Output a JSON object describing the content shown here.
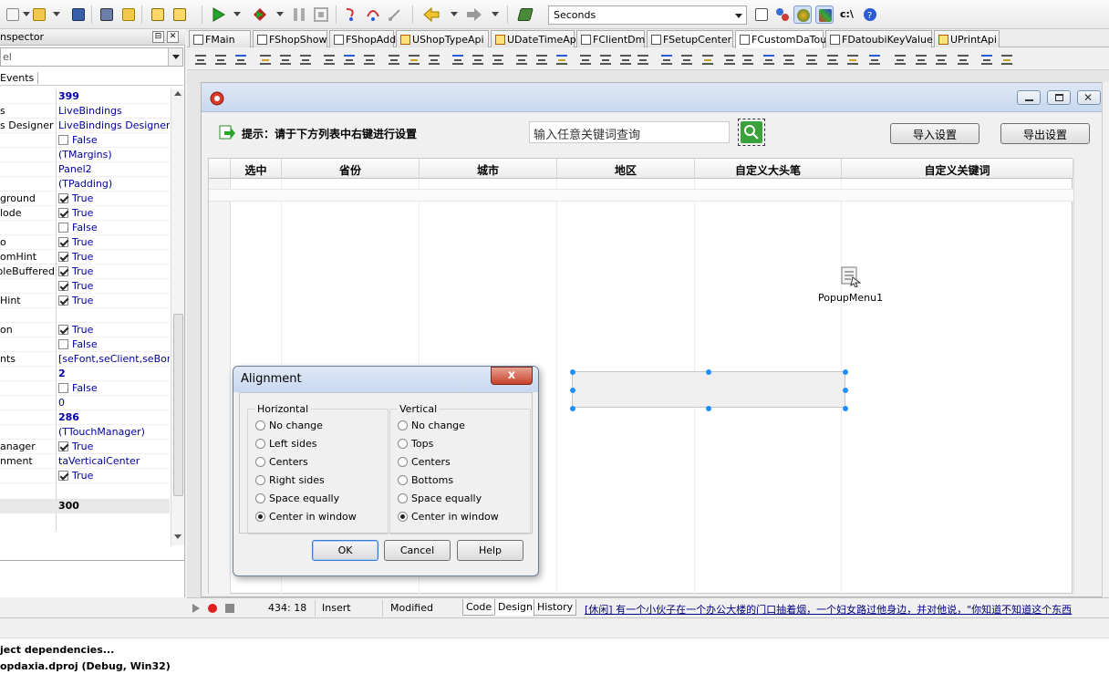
{
  "toolbar": {
    "seconds_value": "Seconds",
    "path_label": "c:\\"
  },
  "inspector": {
    "title": "nspector",
    "combo_value": "el",
    "events_tab": "Events",
    "rows": [
      {
        "name": "",
        "value": "399",
        "bold": true,
        "check": null
      },
      {
        "name": "s",
        "value": "LiveBindings",
        "bold": false,
        "check": null
      },
      {
        "name": "s Designer",
        "value": "LiveBindings Designer",
        "bold": false,
        "check": null
      },
      {
        "name": "",
        "value": "False",
        "bold": false,
        "check": false
      },
      {
        "name": "",
        "value": "(TMargins)",
        "bold": false,
        "check": null
      },
      {
        "name": "",
        "value": "Panel2",
        "bold": false,
        "check": null
      },
      {
        "name": "",
        "value": "(TPadding)",
        "bold": false,
        "check": null
      },
      {
        "name": "ground",
        "value": "True",
        "bold": false,
        "check": true
      },
      {
        "name": "lode",
        "value": "True",
        "bold": false,
        "check": true
      },
      {
        "name": "",
        "value": "False",
        "bold": false,
        "check": false
      },
      {
        "name": "o",
        "value": "True",
        "bold": false,
        "check": true
      },
      {
        "name": "omHint",
        "value": "True",
        "bold": false,
        "check": true
      },
      {
        "name": "oleBuffered",
        "value": "True",
        "bold": false,
        "check": true
      },
      {
        "name": "",
        "value": "True",
        "bold": false,
        "check": true
      },
      {
        "name": "Hint",
        "value": "True",
        "bold": false,
        "check": true
      },
      {
        "name": "",
        "value": "",
        "bold": false,
        "check": null
      },
      {
        "name": "on",
        "value": "True",
        "bold": false,
        "check": true
      },
      {
        "name": "",
        "value": "False",
        "bold": false,
        "check": false
      },
      {
        "name": "nts",
        "value": "[seFont,seClient,seBorde",
        "bold": false,
        "check": null
      },
      {
        "name": "",
        "value": "2",
        "bold": true,
        "check": null
      },
      {
        "name": "",
        "value": "False",
        "bold": false,
        "check": false
      },
      {
        "name": "",
        "value": "0",
        "bold": false,
        "check": null
      },
      {
        "name": "",
        "value": "286",
        "bold": true,
        "check": null
      },
      {
        "name": "",
        "value": "(TTouchManager)",
        "bold": false,
        "check": null
      },
      {
        "name": "anager",
        "value": "True",
        "bold": false,
        "check": true
      },
      {
        "name": "nment",
        "value": "taVerticalCenter",
        "bold": false,
        "check": null
      },
      {
        "name": "",
        "value": "True",
        "bold": false,
        "check": true
      }
    ],
    "selected_value": "300"
  },
  "file_tabs": [
    "FMain",
    "FShopShow",
    "FShopAddEdt",
    "UShopTypeApi",
    "UDateTimeApi",
    "FClientDm",
    "FSetupCenter",
    "FCustomDaTouBi",
    "FDatoubiKeyValue",
    "UPrintApi"
  ],
  "form": {
    "hint_text": "提示：请于下方列表中右键进行设置",
    "search_placeholder": "输入任意关键词查询",
    "import_label": "导入设置",
    "export_label": "导出设置",
    "columns": [
      "选中",
      "省份",
      "城市",
      "地区",
      "自定义大头笔",
      "自定义关键词"
    ],
    "popup_label": "PopupMenu1"
  },
  "dialog": {
    "title": "Alignment",
    "close_label": "x",
    "horizontal_label": "Horizontal",
    "vertical_label": "Vertical",
    "horizontal_options": [
      "No change",
      "Left sides",
      "Centers",
      "Right sides",
      "Space equally",
      "Center in window"
    ],
    "vertical_options": [
      "No change",
      "Tops",
      "Centers",
      "Bottoms",
      "Space equally",
      "Center in window"
    ],
    "horizontal_selected": 5,
    "vertical_selected": 5,
    "ok_label": "OK",
    "cancel_label": "Cancel",
    "help_label": "Help"
  },
  "status": {
    "position": "434:  18",
    "mode": "Insert",
    "state": "Modified",
    "tab_code": "Code",
    "tab_design": "Design",
    "tab_history": "History",
    "ticker": "[休闲] 有一个小伙子在一个办公大楼的门口抽着烟，一个妇女路过他身边，并对他说，\"你知道不知道这个东西"
  },
  "bottom": {
    "line1": "ject dependencies...",
    "line2": "opdaxia.dproj (Debug, Win32)"
  }
}
